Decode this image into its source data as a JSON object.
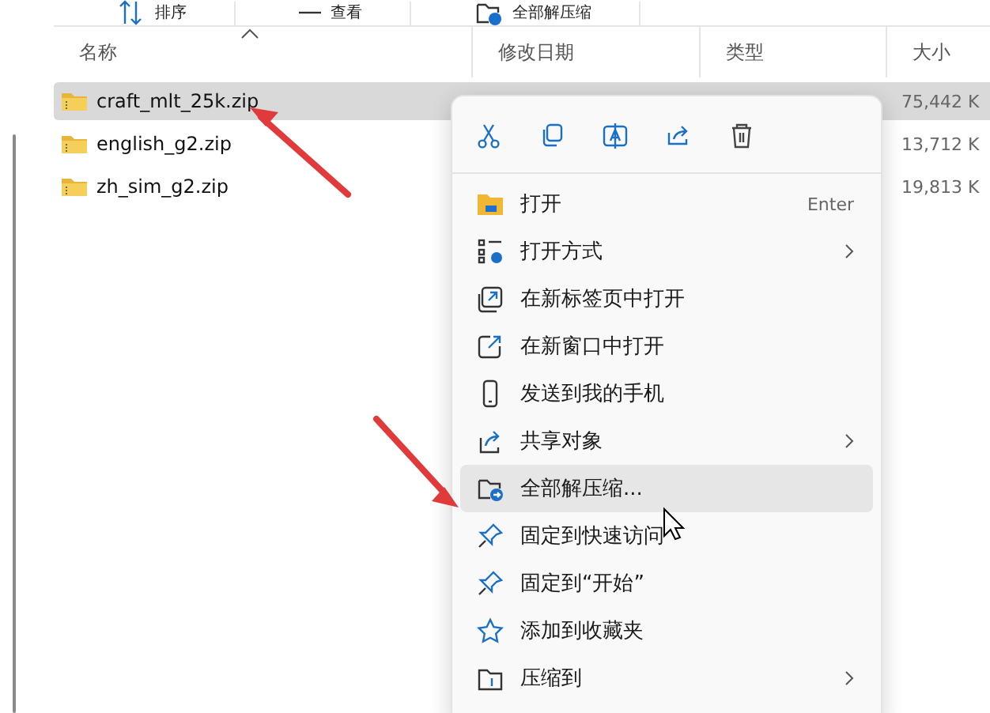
{
  "toolbar": [
    {
      "label": "排序"
    },
    {
      "label": "查看"
    },
    {
      "label": "全部解压缩"
    }
  ],
  "columns": [
    {
      "label": "名称",
      "sorted": true
    },
    {
      "label": "修改日期",
      "sorted": false
    },
    {
      "label": "类型",
      "sorted": false
    },
    {
      "label": "大小",
      "sorted": false
    }
  ],
  "files": [
    {
      "name": "craft_mlt_25k.zip",
      "size": "75,442 K",
      "selected": true
    },
    {
      "name": "english_g2.zip",
      "size": "13,712 K",
      "selected": false
    },
    {
      "name": "zh_sim_g2.zip",
      "size": "19,813 K",
      "selected": false
    }
  ],
  "context_menu": {
    "actions": [
      {
        "kind": "cut"
      },
      {
        "kind": "copy"
      },
      {
        "kind": "rename"
      },
      {
        "kind": "share"
      },
      {
        "kind": "delete"
      }
    ],
    "items": [
      {
        "kind": "open",
        "label": "打开",
        "shortcut": "Enter",
        "submenu": false,
        "selected": false
      },
      {
        "kind": "openwith",
        "label": "打开方式",
        "submenu": true,
        "selected": false
      },
      {
        "kind": "tab",
        "label": "在新标签页中打开",
        "submenu": false,
        "selected": false
      },
      {
        "kind": "window",
        "label": "在新窗口中打开",
        "submenu": false,
        "selected": false
      },
      {
        "kind": "phone",
        "label": "发送到我的手机",
        "submenu": false,
        "selected": false
      },
      {
        "kind": "share",
        "label": "共享对象",
        "submenu": true,
        "selected": false
      },
      {
        "kind": "extract",
        "label": "全部解压缩...",
        "submenu": false,
        "selected": true
      },
      {
        "kind": "pin",
        "label": "固定到快速访问",
        "submenu": false,
        "selected": false
      },
      {
        "kind": "pin",
        "label": "固定到“开始”",
        "submenu": false,
        "selected": false
      },
      {
        "kind": "star",
        "label": "添加到收藏夹",
        "submenu": false,
        "selected": false
      },
      {
        "kind": "zip",
        "label": "压缩到",
        "submenu": true,
        "selected": false
      }
    ]
  }
}
